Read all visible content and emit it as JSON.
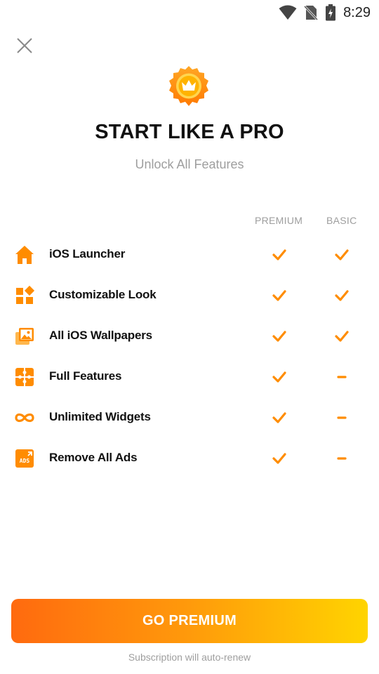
{
  "status_bar": {
    "time": "8:29",
    "icons": [
      "wifi-icon",
      "no-sim-icon",
      "battery-charging-icon"
    ]
  },
  "header": {
    "close_icon": "close-icon",
    "badge_icon": "crown-icon",
    "title": "START LIKE A PRO",
    "subtitle": "Unlock All Features"
  },
  "table": {
    "columns": [
      "PREMIUM",
      "BASIC"
    ],
    "rows": [
      {
        "icon": "home-icon",
        "label": "iOS Launcher",
        "premium": "check",
        "basic": "check"
      },
      {
        "icon": "customize-icon",
        "label": "Customizable Look",
        "premium": "check",
        "basic": "check"
      },
      {
        "icon": "wallpaper-icon",
        "label": "All iOS Wallpapers",
        "premium": "check",
        "basic": "check"
      },
      {
        "icon": "puzzle-icon",
        "label": "Full Features",
        "premium": "check",
        "basic": "dash"
      },
      {
        "icon": "infinity-icon",
        "label": "Unlimited Widgets",
        "premium": "check",
        "basic": "dash"
      },
      {
        "icon": "ads-icon",
        "label": "Remove All Ads",
        "premium": "check",
        "basic": "dash"
      }
    ]
  },
  "cta": {
    "label": "GO PREMIUM"
  },
  "footer": {
    "note": "Subscription will auto-renew"
  },
  "colors": {
    "accent": "#ff8c00",
    "cta_gradient_start": "#ff6a0f",
    "cta_gradient_end": "#ffd400",
    "muted_text": "#9e9e9e"
  }
}
